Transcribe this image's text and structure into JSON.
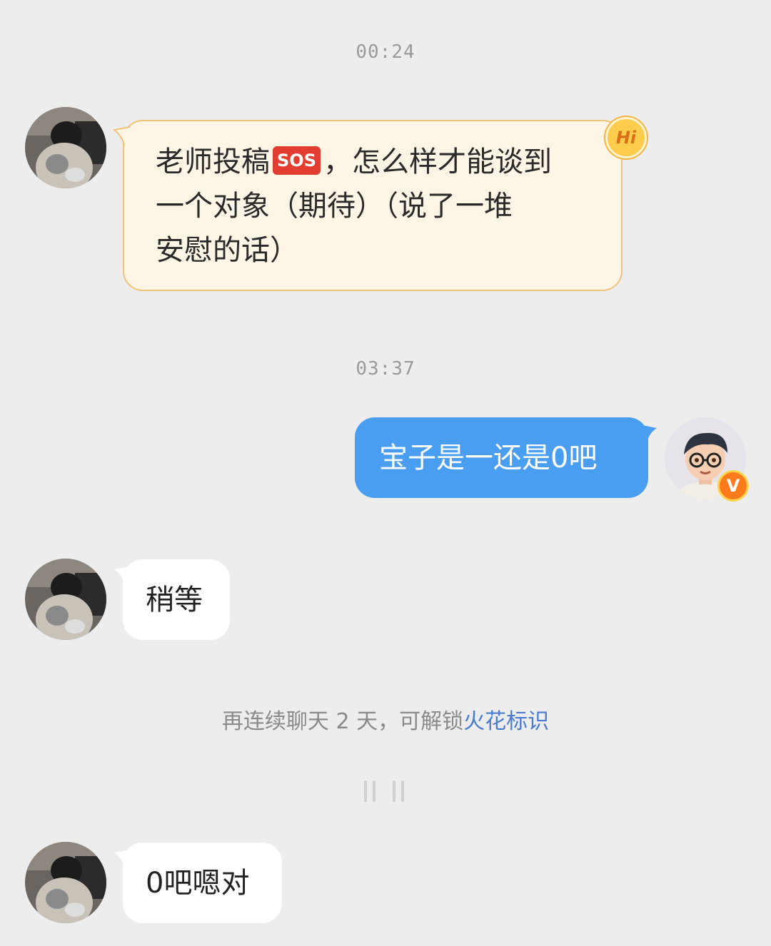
{
  "messages": {
    "ts1": "00:24",
    "msg1": {
      "line1_a": "老师投稿",
      "line1_badge": "SOS",
      "line1_b": "，怎么样才能谈到",
      "line2": "一个对象（期待）（说了一堆",
      "line3": "安慰的话）",
      "hi_badge": "Hi"
    },
    "ts2": "03:37",
    "msg2": "宝子是一还是0吧",
    "msg2_badge": "V",
    "msg3": "稍等",
    "system_note": {
      "prefix": "再连续聊天 2 天，可解锁",
      "link": "火花标识"
    },
    "msg4": "0吧嗯对"
  },
  "colors": {
    "background": "#ededed",
    "outgoing_bubble": "#4a9ef1",
    "incoming_bubble": "#ffffff",
    "hi_bubble": "#fdf6e6",
    "hi_border": "#f1c27a",
    "link": "#4a7bd0"
  }
}
